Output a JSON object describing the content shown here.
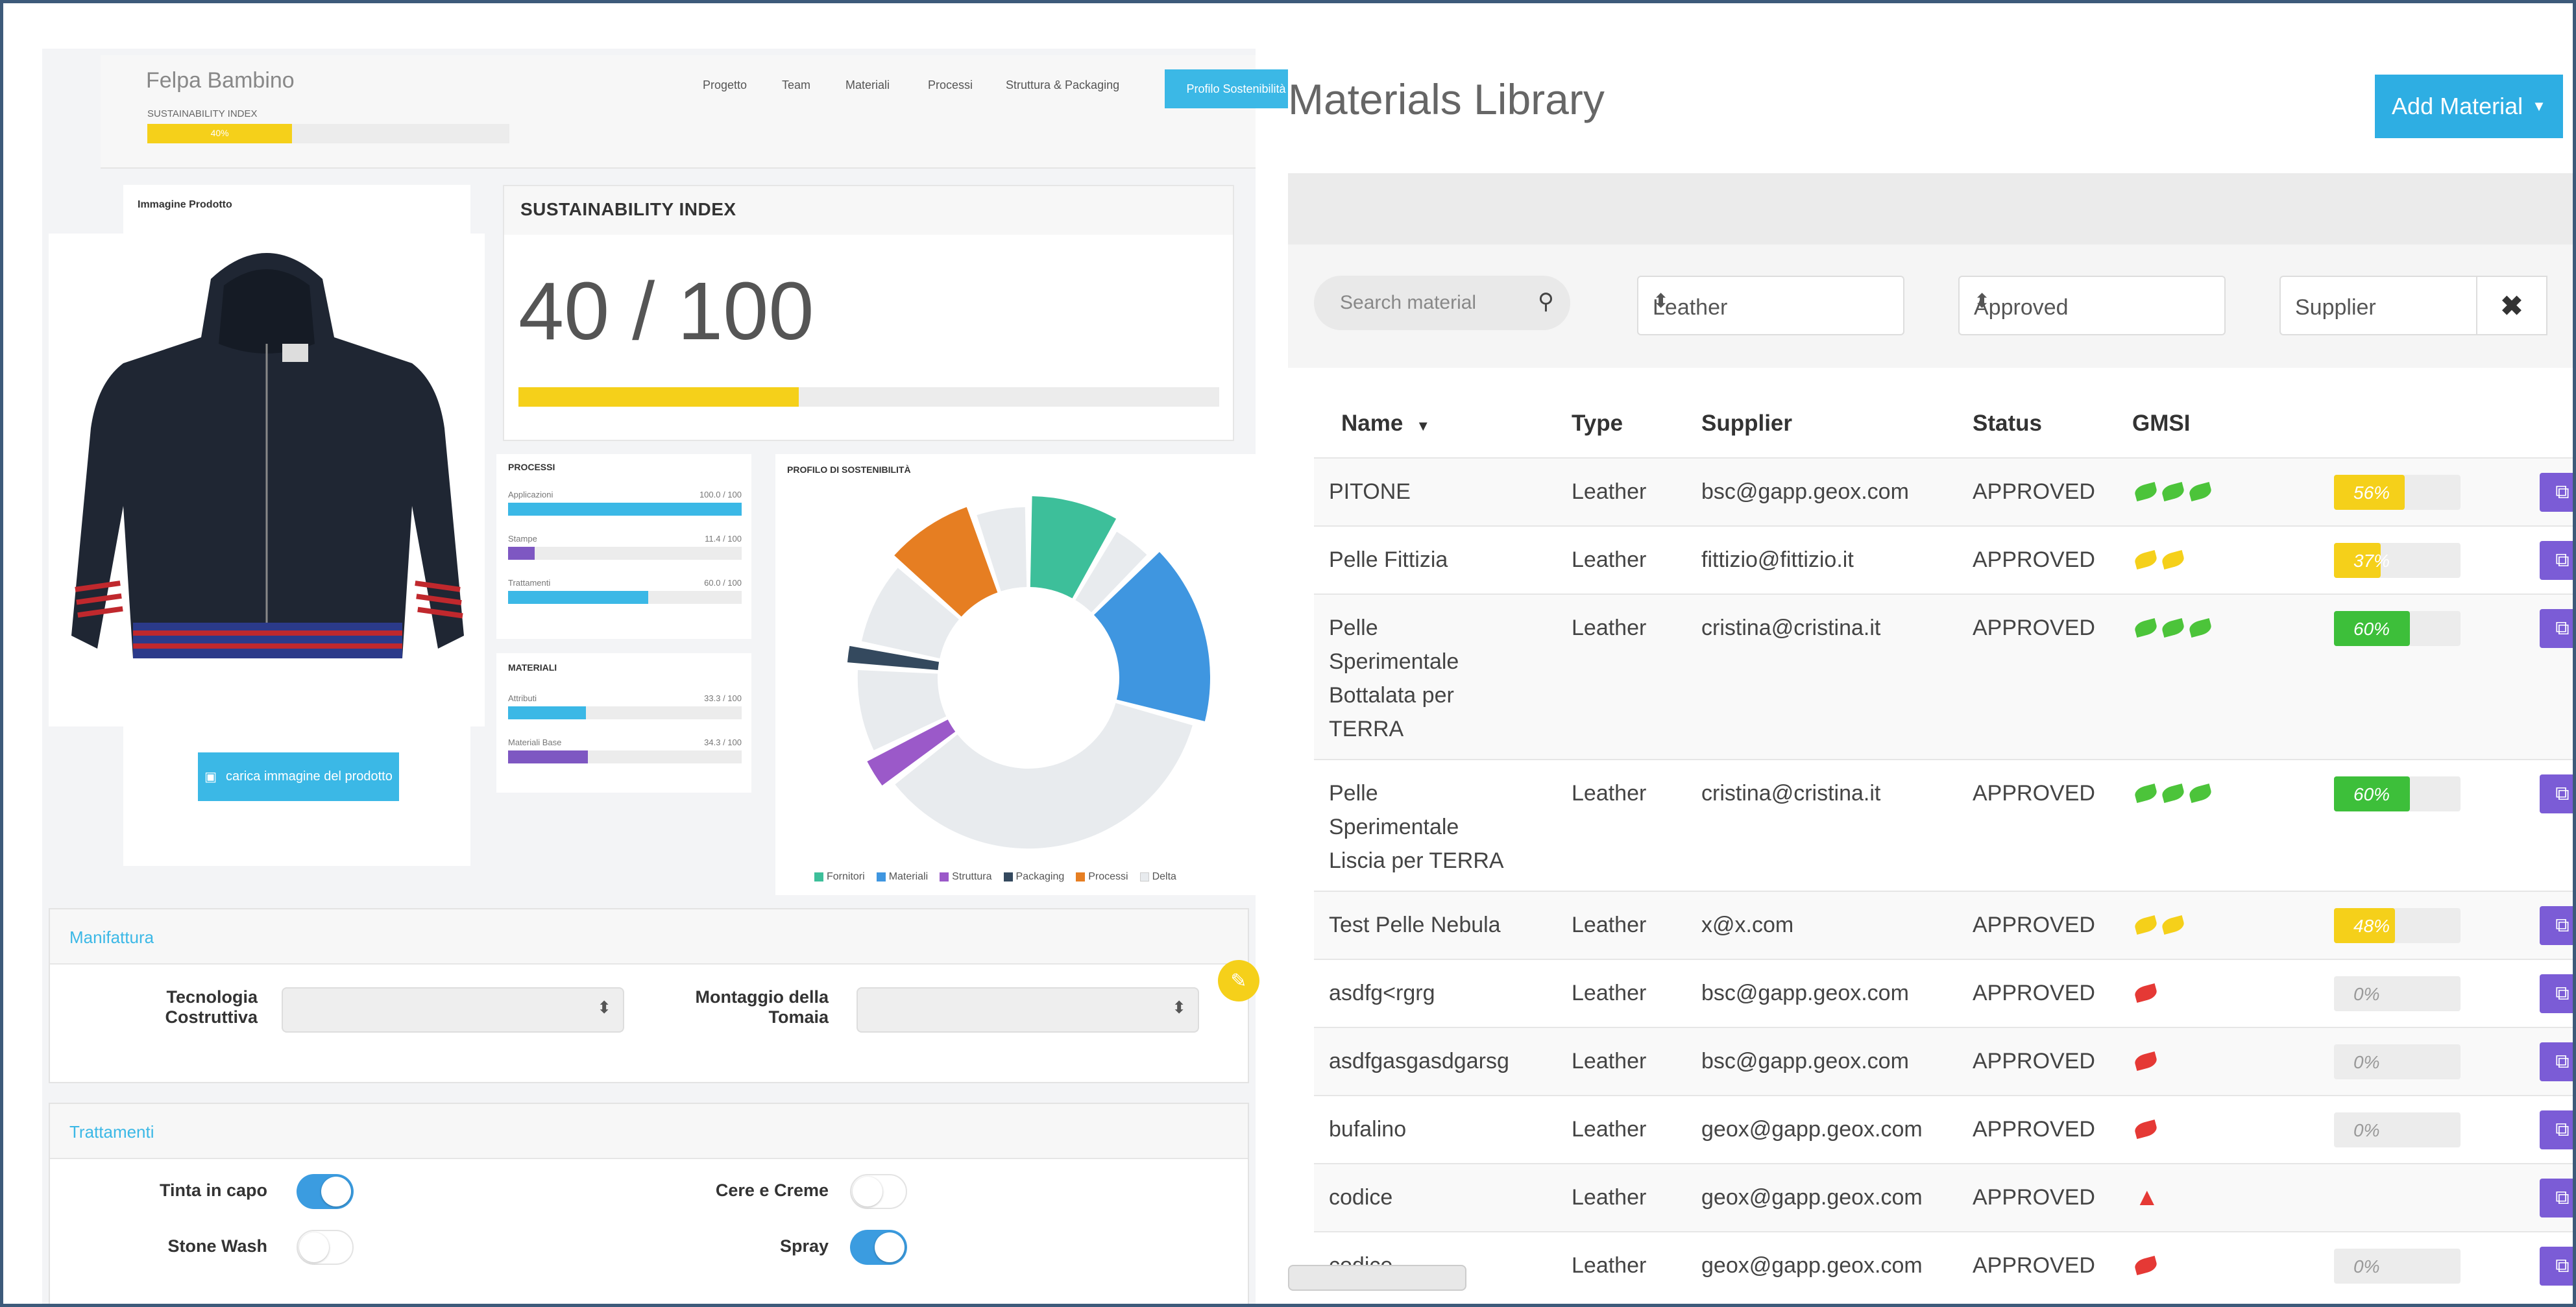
{
  "product": {
    "title": "Felpa Bambino",
    "sustainability_label": "SUSTAINABILITY INDEX",
    "sustainability_pct_text": "40%",
    "sustainability_pct": 40
  },
  "nav": {
    "items": [
      "Progetto",
      "Team",
      "Materiali",
      "Processi",
      "Struttura & Packaging"
    ],
    "active": "Profilo Sostenibilità"
  },
  "image_card": {
    "header": "Immagine Prodotto",
    "upload_label": "carica immagine del prodotto"
  },
  "sustainability_card": {
    "header": "SUSTAINABILITY INDEX",
    "score_text": "40 / 100",
    "score": 40
  },
  "processi": {
    "header": "PROCESSI",
    "items": [
      {
        "label": "Applicazioni",
        "value_text": "100.0 / 100",
        "value": 100,
        "color": "#3bb8e6"
      },
      {
        "label": "Stampe",
        "value_text": "11.4 / 100",
        "value": 11.4,
        "color": "#7e57c2"
      },
      {
        "label": "Trattamenti",
        "value_text": "60.0 / 100",
        "value": 60,
        "color": "#3bb8e6"
      }
    ]
  },
  "materiali": {
    "header": "MATERIALI",
    "items": [
      {
        "label": "Attributi",
        "value_text": "33.3 / 100",
        "value": 33.3,
        "color": "#3bb8e6"
      },
      {
        "label": "Materiali Base",
        "value_text": "34.3 / 100",
        "value": 34.3,
        "color": "#7e57c2"
      }
    ]
  },
  "profilo": {
    "header": "PROFILO DI SOSTENIBILITÀ",
    "legend": [
      {
        "label": "Fornitori",
        "color": "#3dbf9a"
      },
      {
        "label": "Materiali",
        "color": "#3f96e0"
      },
      {
        "label": "Struttura",
        "color": "#9b59c9"
      },
      {
        "label": "Packaging",
        "color": "#34495e"
      },
      {
        "label": "Processi",
        "color": "#e67e22"
      },
      {
        "label": "Delta",
        "color": "#e8ebee"
      }
    ]
  },
  "chart_data": {
    "type": "pie",
    "categories": [
      "Fornitori",
      "Delta",
      "Materiali",
      "Delta",
      "Struttura",
      "Delta",
      "Packaging",
      "Delta",
      "Processi",
      "Delta"
    ],
    "values": [
      8,
      4,
      16,
      34,
      3,
      8,
      2,
      8,
      8,
      5
    ],
    "colors": [
      "#3dbf9a",
      "#e8ebee",
      "#3f96e0",
      "#e8ebee",
      "#9b59c9",
      "#e8ebee",
      "#34495e",
      "#e8ebee",
      "#e67e22",
      "#e8ebee"
    ],
    "title": "PROFILO DI SOSTENIBILITÀ",
    "legend_position": "bottom"
  },
  "manifattura": {
    "header": "Manifattura",
    "field1_label_line1": "Tecnologia",
    "field1_label_line2": "Costruttiva",
    "field2_label_line1": "Montaggio della",
    "field2_label_line2": "Tomaia"
  },
  "trattamenti": {
    "header": "Trattamenti",
    "toggles": [
      {
        "label": "Tinta in capo",
        "on": true
      },
      {
        "label": "Cere e Creme",
        "on": false
      },
      {
        "label": "Stone Wash",
        "on": false
      },
      {
        "label": "Spray",
        "on": true
      }
    ]
  },
  "library": {
    "title": "Materials Library",
    "add_button": "Add Material",
    "search_placeholder": "Search material",
    "filter_type": "Leather",
    "filter_status": "Approved",
    "supplier_placeholder": "Supplier",
    "columns": {
      "name": "Name",
      "type": "Type",
      "supplier": "Supplier",
      "status": "Status",
      "gmsi": "GMSI"
    },
    "rows": [
      {
        "name": [
          "PITONE"
        ],
        "type": "Leather",
        "supplier": "bsc@gapp.geox.com",
        "status": "APPROVED",
        "leaves": 3,
        "leaf_color": "#4cc43a",
        "pct_text": "56%",
        "pct": 56,
        "bar_color": "#f5d01a"
      },
      {
        "name": [
          "Pelle Fittizia"
        ],
        "type": "Leather",
        "supplier": "fittizio@fittizio.it",
        "status": "APPROVED",
        "leaves": 2,
        "leaf_color": "#f5d01a",
        "pct_text": "37%",
        "pct": 37,
        "bar_color": "#f5d01a"
      },
      {
        "name": [
          "Pelle",
          "Sperimentale",
          "Bottalata per",
          "TERRA"
        ],
        "type": "Leather",
        "supplier": "cristina@cristina.it",
        "status": "APPROVED",
        "leaves": 3,
        "leaf_color": "#4cc43a",
        "pct_text": "60%",
        "pct": 60,
        "bar_color": "#3dbf3a"
      },
      {
        "name": [
          "Pelle",
          "Sperimentale",
          "Liscia per TERRA"
        ],
        "type": "Leather",
        "supplier": "cristina@cristina.it",
        "status": "APPROVED",
        "leaves": 3,
        "leaf_color": "#4cc43a",
        "pct_text": "60%",
        "pct": 60,
        "bar_color": "#3dbf3a"
      },
      {
        "name": [
          "Test Pelle Nebula"
        ],
        "type": "Leather",
        "supplier": "x@x.com",
        "status": "APPROVED",
        "leaves": 2,
        "leaf_color": "#f5d01a",
        "pct_text": "48%",
        "pct": 48,
        "bar_color": "#f5d01a"
      },
      {
        "name": [
          "asdfg<rgrg"
        ],
        "type": "Leather",
        "supplier": "bsc@gapp.geox.com",
        "status": "APPROVED",
        "leaves": 1,
        "leaf_color": "#e53935",
        "pct_text": "0%",
        "pct": 0,
        "bar_color": "#ececec"
      },
      {
        "name": [
          "asdfgasgasdgarsg"
        ],
        "type": "Leather",
        "supplier": "bsc@gapp.geox.com",
        "status": "APPROVED",
        "leaves": 1,
        "leaf_color": "#e53935",
        "pct_text": "0%",
        "pct": 0,
        "bar_color": "#ececec"
      },
      {
        "name": [
          "bufalino"
        ],
        "type": "Leather",
        "supplier": "geox@gapp.geox.com",
        "status": "APPROVED",
        "leaves": 1,
        "leaf_color": "#e53935",
        "pct_text": "0%",
        "pct": 0,
        "bar_color": "#ececec"
      },
      {
        "name": [
          "codice"
        ],
        "type": "Leather",
        "supplier": "geox@gapp.geox.com",
        "status": "APPROVED",
        "leaves": 0,
        "warning": true,
        "leaf_color": "#e53935",
        "pct_text": "",
        "pct": 0,
        "bar_color": "#ececec"
      },
      {
        "name": [
          "codice"
        ],
        "type": "Leather",
        "supplier": "geox@gapp.geox.com",
        "status": "APPROVED",
        "leaves": 1,
        "leaf_color": "#e53935",
        "pct_text": "0%",
        "pct": 0,
        "bar_color": "#ececec"
      }
    ]
  }
}
